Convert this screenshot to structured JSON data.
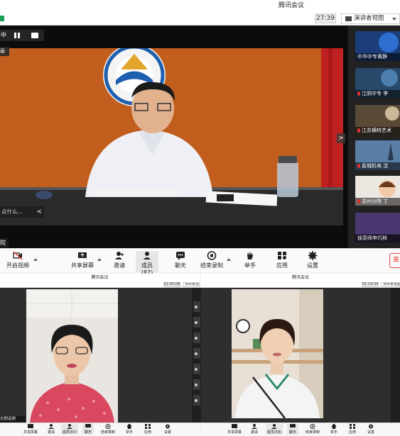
{
  "window": {
    "title": "腾讯会议",
    "timer": "27:39",
    "view_label": "演讲者视图"
  },
  "stage": {
    "chip_label": "中",
    "chip2_label": "画",
    "caption_text": "点什么...",
    "caption_arrow": "<",
    "speaker_name_fragment": "院",
    "strip_arrow": ">"
  },
  "participants": [
    {
      "name": "中华中专黄静",
      "muted": false
    },
    {
      "name": "江阴中专 李",
      "muted": true
    },
    {
      "name": "江苏横特艺术",
      "muted": true
    },
    {
      "name": "盐城机电 沈",
      "muted": true
    },
    {
      "name": "苏州分院 丁",
      "muted": true
    },
    {
      "name": "徐高师申巧林",
      "muted": false
    }
  ],
  "toolbar": {
    "items": [
      {
        "label": "开启视频",
        "icon": "video-off-icon"
      },
      {
        "label": "共享屏幕",
        "icon": "share-screen-icon"
      },
      {
        "label": "邀请",
        "icon": "invite-icon"
      },
      {
        "label": "成员(87)",
        "icon": "members-icon"
      },
      {
        "label": "聊天",
        "icon": "chat-icon"
      },
      {
        "label": "结束录制",
        "icon": "stop-record-icon"
      },
      {
        "label": "举手",
        "icon": "raise-hand-icon"
      },
      {
        "label": "应用",
        "icon": "apps-icon"
      },
      {
        "label": "设置",
        "icon": "settings-icon"
      }
    ],
    "end_label": "离"
  },
  "left_window": {
    "title": "腾讯会议",
    "timer": "01:00:06",
    "view_label": "演讲者视图",
    "caption": "交割话谢",
    "toolbar": [
      "共享屏幕",
      "邀请",
      "成员(87)",
      "聊天",
      "结束录制",
      "举手",
      "应用",
      "设置"
    ]
  },
  "right_window": {
    "title": "腾讯会议",
    "timer": "01:14:34",
    "view_label": "演讲者视图",
    "toolbar": [
      "共享屏幕",
      "邀请",
      "成员(58)",
      "聊天",
      "结束录制",
      "举手",
      "应用",
      "设置"
    ]
  },
  "colors": {
    "toolbar_bg": "#fafafa",
    "stage_bg": "#0c0c0c",
    "end_red": "#e54545",
    "signal_green": "#18a058"
  }
}
